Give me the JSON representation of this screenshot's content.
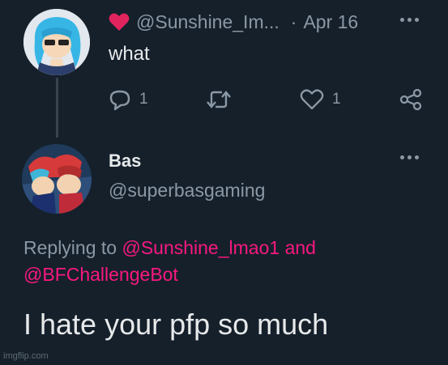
{
  "tweet1": {
    "handle": "@Sunshine_Im...",
    "separator": "·",
    "date": "Apr 16",
    "text": "what",
    "reply_count": "1",
    "retweet_count": "",
    "like_count": "1"
  },
  "tweet2": {
    "display_name": "Bas",
    "handle": "@superbasgaming",
    "replying_prefix": "Replying to",
    "replying_mention1": "@Sunshine_lmao1",
    "replying_and": "and",
    "replying_mention2": "@BFChallengeBot",
    "text": "I hate your pfp so much"
  },
  "watermark": "imgflip.com",
  "colors": {
    "background": "#15202b",
    "accent_pink": "#f91880",
    "heart_red": "#e0245e",
    "secondary_text": "#8b98a5"
  },
  "icons": [
    "heart-icon",
    "reply-icon",
    "retweet-icon",
    "like-icon",
    "share-icon",
    "more-icon"
  ]
}
